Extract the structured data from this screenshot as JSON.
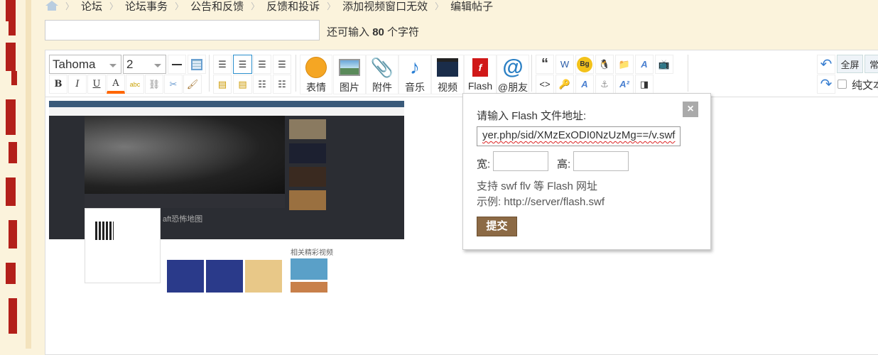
{
  "breadcrumb": [
    "论坛",
    "论坛事务",
    "公告和反馈",
    "反馈和投诉",
    "添加视频窗口无效",
    "编辑帖子"
  ],
  "title_input": {
    "value": "",
    "remaining_prefix": "还可输入",
    "remaining_count": "80",
    "remaining_suffix": "个字符"
  },
  "toolbar": {
    "font": "Tahoma",
    "size": "2",
    "bold": "B",
    "italic": "I",
    "underline": "U",
    "color": "A",
    "big_buttons": [
      {
        "label": "表情",
        "icon": "smiley-icon"
      },
      {
        "label": "图片",
        "icon": "image-icon"
      },
      {
        "label": "附件",
        "icon": "paperclip-icon"
      },
      {
        "label": "音乐",
        "icon": "music-icon"
      },
      {
        "label": "视频",
        "icon": "video-icon"
      },
      {
        "label": "Flash",
        "icon": "flash-icon"
      },
      {
        "label": "@朋友",
        "icon": "at-icon"
      }
    ],
    "quote": "“",
    "code": "<>",
    "bg": "Bg",
    "fullscreen": "全屏",
    "common": "常",
    "plaintext": "纯文本"
  },
  "flash_dialog": {
    "title": "请输入 Flash 文件地址:",
    "url_value": "yer.php/sid/XMzExODI0NzUzMg==/v.swf",
    "width_label": "宽:",
    "height_label": "高:",
    "hint1": "支持 swf flv 等 Flash 网址",
    "hint2": "示例: http://server/flash.swf",
    "close": "×",
    "submit": "提交"
  },
  "embedded_screenshot": {
    "related_title": "相关精彩视频",
    "video_title": "aft恐怖地图"
  }
}
